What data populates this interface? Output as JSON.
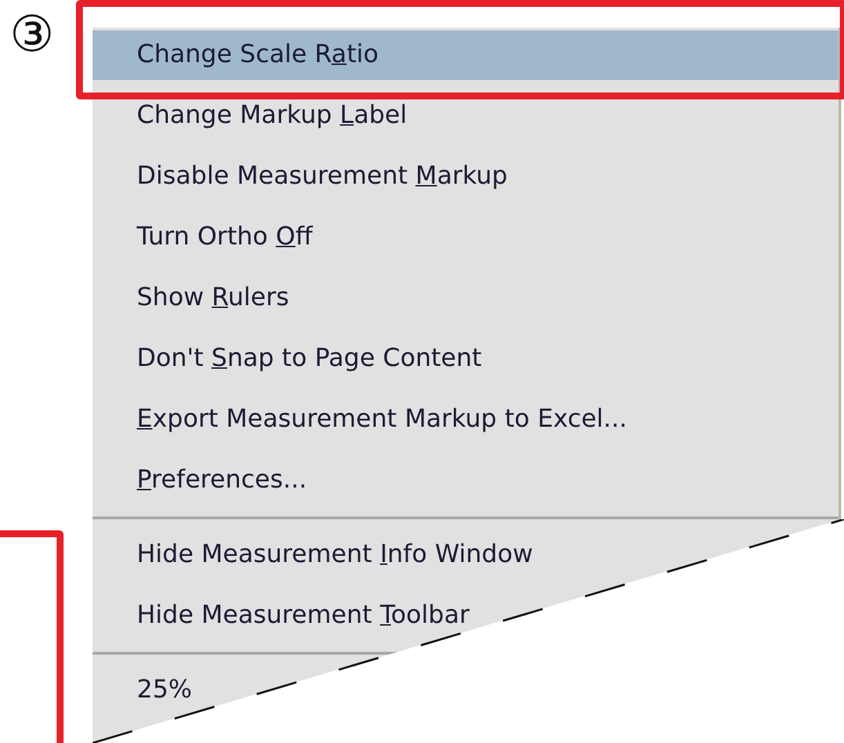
{
  "step_marker": "③",
  "menu": {
    "items": [
      {
        "kind": "item",
        "before": "Change Scale R",
        "key": "a",
        "after": "tio",
        "selected": true
      },
      {
        "kind": "item",
        "before": "Change Markup ",
        "key": "L",
        "after": "abel",
        "selected": false
      },
      {
        "kind": "item",
        "before": "Disable Measurement ",
        "key": "M",
        "after": "arkup",
        "selected": false
      },
      {
        "kind": "item",
        "before": "Turn Ortho ",
        "key": "O",
        "after": "ff",
        "selected": false
      },
      {
        "kind": "item",
        "before": "Show ",
        "key": "R",
        "after": "ulers",
        "selected": false
      },
      {
        "kind": "item",
        "before": "Don't ",
        "key": "S",
        "after": "nap to Page Content",
        "selected": false
      },
      {
        "kind": "item",
        "key": "E",
        "after": "xport Measurement Markup to Excel...",
        "selected": false
      },
      {
        "kind": "item",
        "key": "P",
        "after": "references...",
        "selected": false
      },
      {
        "kind": "separator"
      },
      {
        "kind": "item",
        "before": "Hide Measurement ",
        "key": "I",
        "after": "nfo Window",
        "selected": false
      },
      {
        "kind": "item",
        "before": "Hide Measurement ",
        "key": "T",
        "after": "oolbar",
        "selected": false
      },
      {
        "kind": "separator"
      },
      {
        "kind": "item",
        "before": "25%",
        "selected": false
      }
    ]
  }
}
